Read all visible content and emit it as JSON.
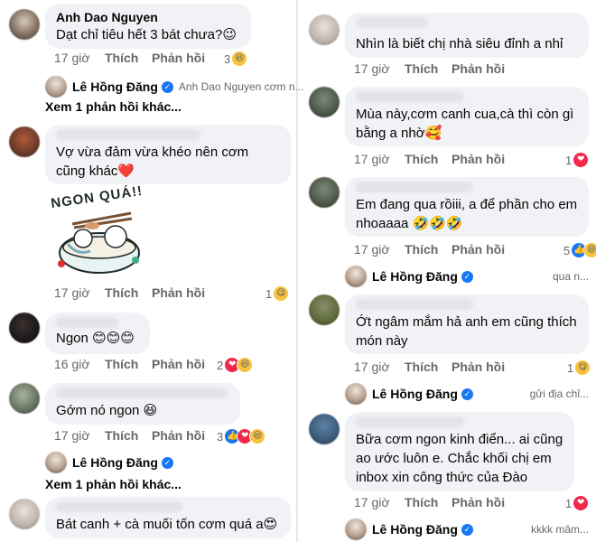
{
  "left": {
    "c1": {
      "name": "Anh Dao Nguyen",
      "text": "Dạt chỉ tiêu hết 3 bát chưa?😉",
      "time": "17 giờ",
      "like": "Thích",
      "reply": "Phản hồi",
      "react_count": "3",
      "react_emoji": "😆",
      "reply_preview": {
        "name": "Lê Hồng Đăng",
        "text": "Anh Dao Nguyen cơm n..."
      },
      "more": "Xem 1 phản hồi khác..."
    },
    "c2": {
      "text_line1": "Vợ vừa đảm vừa khéo  nên cơm",
      "text_line2": "cũng khác❤️",
      "sticker_text": "NGON QUÁ!!",
      "time": "17 giờ",
      "like": "Thích",
      "reply": "Phản hồi",
      "react_count": "1",
      "react_emoji": "😋"
    },
    "c3": {
      "text": "Ngon 😊😊😊",
      "time": "16 giờ",
      "like": "Thích",
      "reply": "Phản hồi",
      "react_count": "2",
      "react_emoji_1": "❤",
      "react_emoji_2": "😆"
    },
    "c4": {
      "text": "Gớm nó ngon 😆",
      "time": "17 giờ",
      "like": "Thích",
      "reply": "Phản hồi",
      "react_count": "3",
      "react_emoji_1": "👍",
      "react_emoji_2": "❤",
      "react_emoji_3": "😆",
      "reply_preview": {
        "name": "Lê Hồng Đăng"
      },
      "more": "Xem 1 phản hồi khác..."
    },
    "c5": {
      "text": "Bát canh + cà muối tốn cơm quá a😍"
    }
  },
  "right": {
    "c1": {
      "text": "Nhìn là biết chị nhà siêu đỉnh a nhỉ",
      "time": "17 giờ",
      "like": "Thích",
      "reply": "Phản hồi"
    },
    "c2": {
      "text_line1": "Mùa này,cơm canh cua,cà thì còn gì",
      "text_line2": "bằng a nhờ🥰",
      "time": "17 giờ",
      "like": "Thích",
      "reply": "Phản hồi",
      "react_count": "1",
      "react_emoji": "❤"
    },
    "c3": {
      "text_line1": "Em đang qua rồiii, a để phần cho em",
      "text_line2": "nhoaaaa 🤣🤣🤣",
      "time": "17 giờ",
      "like": "Thích",
      "reply": "Phản hồi",
      "react_count": "5",
      "react_emoji_1": "👍",
      "react_emoji_2": "😆",
      "reply_preview": {
        "name": "Lê Hồng Đăng",
        "text": "qua n..."
      }
    },
    "c4": {
      "text_line1": "Ớt ngâm mắm hả anh em cũng thích",
      "text_line2": "món này",
      "time": "17 giờ",
      "like": "Thích",
      "reply": "Phản hồi",
      "react_count": "1",
      "react_emoji": "😋",
      "reply_preview": {
        "name": "Lê Hồng Đăng",
        "text": "gửi địa chỉ..."
      }
    },
    "c5": {
      "text_line1": "Bữa cơm ngon kinh điển... ai cũng",
      "text_line2": "ao ước luôn e. Chắc khối chị em",
      "text_line3": "inbox xin công thức của Đào",
      "time": "17 giờ",
      "like": "Thích",
      "reply": "Phản hồi",
      "react_count": "1",
      "react_emoji": "❤",
      "reply_preview": {
        "name": "Lê Hồng Đăng",
        "text": "kkkk mâm..."
      }
    }
  },
  "colors": {
    "bubble": "#f0f2f5",
    "meta": "#65676b",
    "verified": "#1877f2"
  }
}
